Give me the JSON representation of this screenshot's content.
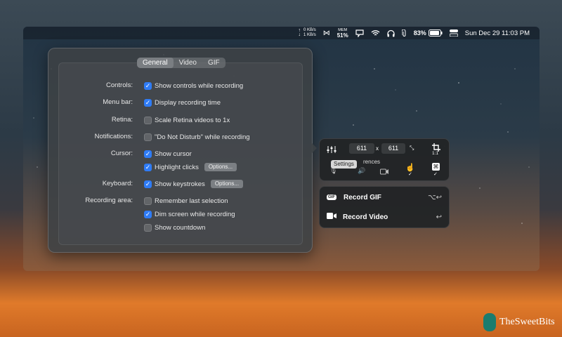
{
  "menubar": {
    "net_up": "0 KB/s",
    "net_down": "1 KB/s",
    "mem_label": "MEM",
    "mem_value": "51%",
    "battery": "83%",
    "datetime": "Sun Dec 29  11:03 PM"
  },
  "prefs": {
    "tabs": [
      "General",
      "Video",
      "GIF"
    ],
    "active_tab": "General",
    "rows": [
      {
        "label": "Controls:",
        "option": "Show controls while recording",
        "checked": true
      },
      {
        "label": "Menu bar:",
        "option": "Display recording time",
        "checked": true
      },
      {
        "label": "Retina:",
        "option": "Scale Retina videos to 1x",
        "checked": false
      },
      {
        "label": "Notifications:",
        "option": "\"Do Not Disturb\" while recording",
        "checked": false
      },
      {
        "label": "Cursor:",
        "option": "Show cursor",
        "checked": true
      },
      {
        "label": "",
        "option": "Highlight clicks",
        "checked": true,
        "button": "Options..."
      },
      {
        "label": "Keyboard:",
        "option": "Show keystrokes",
        "checked": true,
        "button": "Options..."
      },
      {
        "label": "Recording area:",
        "option": "Remember last selection",
        "checked": false
      },
      {
        "label": "",
        "option": "Dim screen while recording",
        "checked": true
      },
      {
        "label": "",
        "option": "Show countdown",
        "checked": false
      }
    ]
  },
  "panel": {
    "width": "611",
    "height": "611",
    "times": "x",
    "ratio": "1:1",
    "tooltip": "Settings",
    "behind_text": "rences"
  },
  "actions": {
    "record_gif": "Record GIF",
    "record_video": "Record Video",
    "gif_badge": "GIF",
    "gif_shortcut": "⌥↩",
    "video_shortcut": "↩"
  },
  "brand": {
    "name": "TheSweetBits"
  }
}
